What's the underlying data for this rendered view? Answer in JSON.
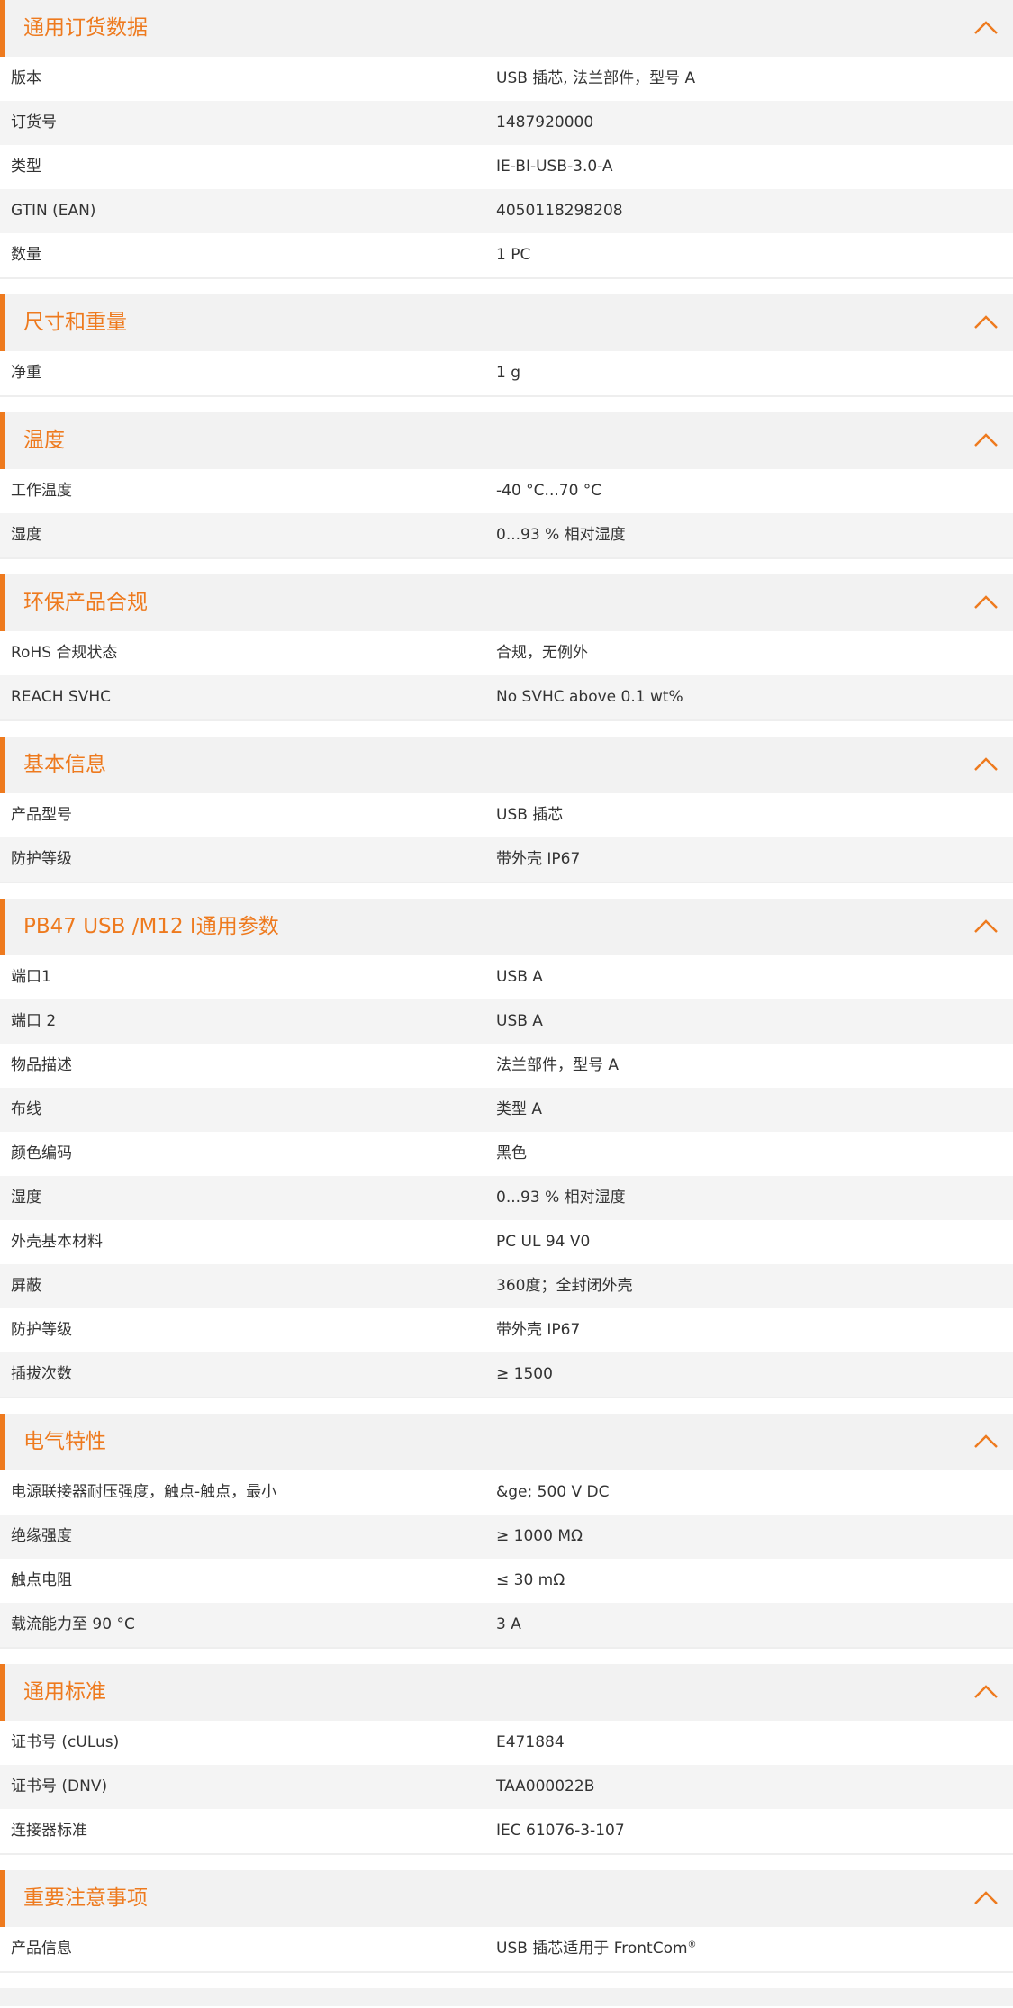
{
  "accent_color": "#ee7a1e",
  "collapse_icon": "chevron-up-icon",
  "sections": [
    {
      "title": "通用订货数据",
      "rows": [
        {
          "label": "版本",
          "value": "USB 插芯, 法兰部件，型号 A"
        },
        {
          "label": "订货号",
          "value": "1487920000"
        },
        {
          "label": "类型",
          "value": "IE-BI-USB-3.0-A"
        },
        {
          "label": "GTIN (EAN)",
          "value": "4050118298208"
        },
        {
          "label": "数量",
          "value": "1  PC"
        }
      ]
    },
    {
      "title": "尺寸和重量",
      "rows": [
        {
          "label": "净重",
          "value": "1  g"
        }
      ]
    },
    {
      "title": "温度",
      "rows": [
        {
          "label": "工作温度",
          "value": "-40 °C...70 °C"
        },
        {
          "label": "湿度",
          "value": "0...93 % 相对湿度"
        }
      ]
    },
    {
      "title": "环保产品合规",
      "rows": [
        {
          "label": "RoHS 合规状态",
          "value": "合规，无例外"
        },
        {
          "label": "REACH SVHC",
          "value": "No SVHC above 0.1 wt%"
        }
      ]
    },
    {
      "title": "基本信息",
      "rows": [
        {
          "label": "产品型号",
          "value": "USB 插芯"
        },
        {
          "label": "防护等级",
          "value": "带外壳 IP67"
        }
      ]
    },
    {
      "title": "PB47 USB /M12 I通用参数",
      "rows": [
        {
          "label": "端口1",
          "value": "USB A"
        },
        {
          "label": "端口 2",
          "value": "USB A"
        },
        {
          "label": "物品描述",
          "value": "法兰部件，型号 A"
        },
        {
          "label": "布线",
          "value": "类型 A"
        },
        {
          "label": "颜色编码",
          "value": "黑色"
        },
        {
          "label": "湿度",
          "value": "0...93 % 相对湿度"
        },
        {
          "label": "外壳基本材料",
          "value": "PC UL 94 V0"
        },
        {
          "label": "屏蔽",
          "value": "360度；全封闭外壳"
        },
        {
          "label": "防护等级",
          "value": "带外壳 IP67"
        },
        {
          "label": "插拔次数",
          "value": "≥ 1500"
        }
      ]
    },
    {
      "title": "电气特性",
      "rows": [
        {
          "label": "电源联接器耐压强度，触点-触点，最小",
          "value": "&ge; 500 V DC"
        },
        {
          "label": "绝缘强度",
          "value": "≥ 1000 MΩ"
        },
        {
          "label": "触点电阻",
          "value": "≤ 30 mΩ"
        },
        {
          "label": "载流能力至 90 °C",
          "value": "3  A"
        }
      ]
    },
    {
      "title": "通用标准",
      "rows": [
        {
          "label": "证书号 (cULus)",
          "value": "E471884"
        },
        {
          "label": "证书号 (DNV)",
          "value": "TAA000022B"
        },
        {
          "label": "连接器标准",
          "value": "IEC 61076-3-107"
        }
      ]
    },
    {
      "title": "重要注意事项",
      "rows": [
        {
          "label": "产品信息",
          "value": "USB 插芯适用于 FrontCom",
          "sup": "®"
        }
      ]
    }
  ]
}
